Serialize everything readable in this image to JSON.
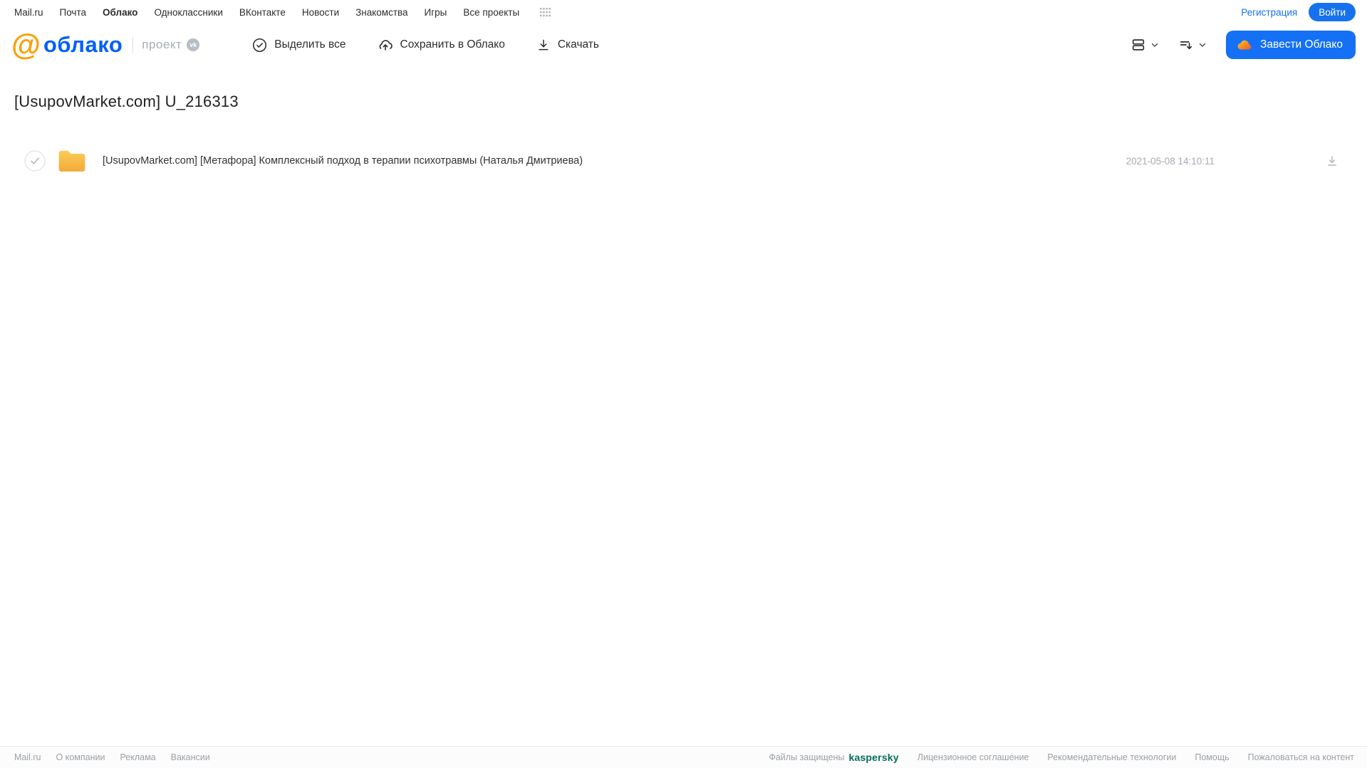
{
  "top_nav": {
    "links": [
      {
        "label": "Mail.ru"
      },
      {
        "label": "Почта"
      },
      {
        "label": "Облако",
        "active": true
      },
      {
        "label": "Одноклассники"
      },
      {
        "label": "ВКонтакте"
      },
      {
        "label": "Новости"
      },
      {
        "label": "Знакомства"
      },
      {
        "label": "Игры"
      },
      {
        "label": "Все проекты"
      }
    ],
    "registration_label": "Регистрация",
    "login_label": "Войти"
  },
  "header": {
    "logo_at": "@",
    "logo_text": "облако",
    "project_label": "проект",
    "vk_badge": "vk",
    "toolbar": {
      "select_all_label": "Выделить все",
      "save_to_cloud_label": "Сохранить в Облако",
      "download_label": "Скачать"
    },
    "create_cloud_label": "Завести Облако"
  },
  "main": {
    "title": "[UsupovMarket.com] U_216313",
    "files": [
      {
        "type": "folder",
        "name": "[UsupovMarket.com] [Метафора] Комплексный подход в терапии психотравмы (Наталья Дмитриева)",
        "date": "2021-05-08 14:10:11"
      }
    ]
  },
  "footer": {
    "left_links": [
      "Mail.ru",
      "О компании",
      "Реклама",
      "Вакансии"
    ],
    "protected_label": "Файлы защищены",
    "kaspersky_label": "kaspersky",
    "right_links": [
      "Лицензионное соглашение",
      "Рекомендательные технологии",
      "Помощь",
      "Пожаловаться на контент"
    ]
  },
  "colors": {
    "accent_blue": "#1470f5",
    "logo_orange": "#ff9e00",
    "logo_blue": "#005ff9",
    "folder_yellow": "#f5b940",
    "kaspersky_teal": "#006d5c",
    "text_dark": "#2c2d2e",
    "text_gray": "#a6aab2"
  }
}
